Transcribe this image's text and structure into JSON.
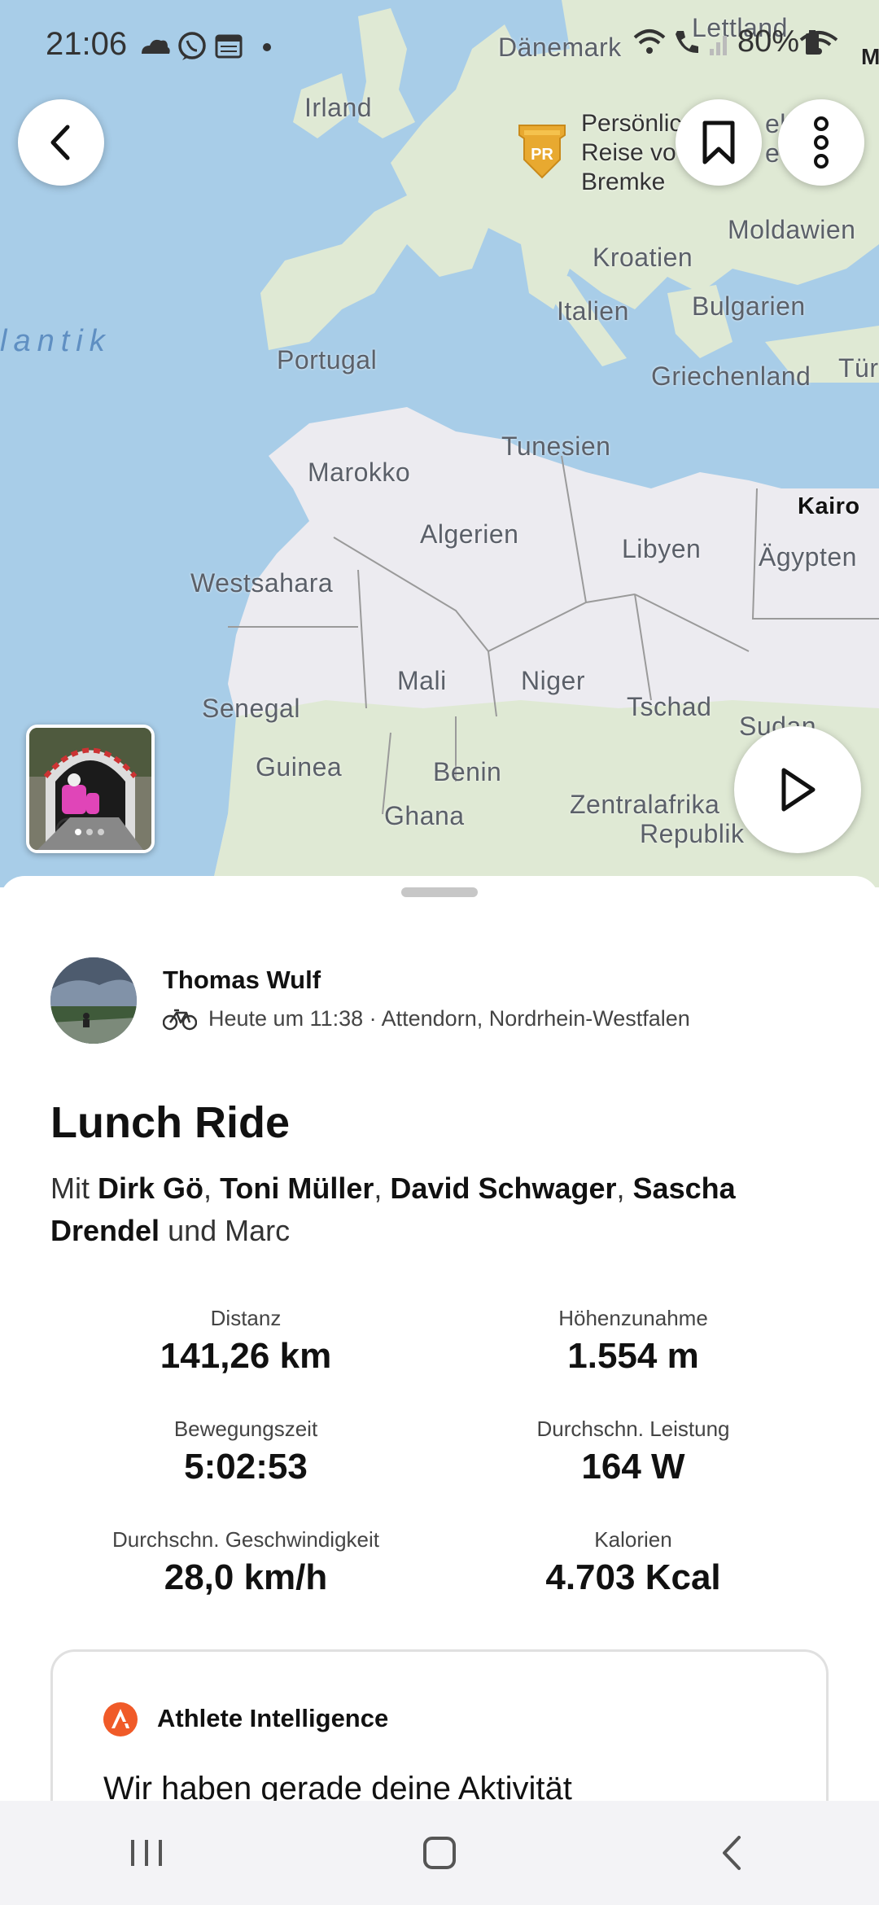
{
  "status_bar": {
    "time": "21:06",
    "battery": "80%",
    "left_icons": [
      "cloud-icon",
      "whatsapp-icon",
      "calendar-icon",
      "dot-icon"
    ],
    "right_icons": [
      "wifi-icon",
      "wifi-call-icon",
      "signal-icon",
      "battery-icon"
    ]
  },
  "map": {
    "labels": {
      "lettland": "Lettland",
      "daenemark": "Dänemark",
      "irland": "Irland",
      "moldawien": "Moldawien",
      "kroatien": "Kroatien",
      "italien": "Italien",
      "bulgarien": "Bulgarien",
      "atlantik": "lantik",
      "portugal": "Portugal",
      "griechenland": "Griechenland",
      "tuerkei": "Tür",
      "tunesien": "Tunesien",
      "marokko": "Marokko",
      "kairo": "Kairo",
      "algerien": "Algerien",
      "libyen": "Libyen",
      "aegypten": "Ägypten",
      "westsahara": "Westsahara",
      "mali": "Mali",
      "niger": "Niger",
      "tschad": "Tschad",
      "senegal": "Senegal",
      "sudan": "Sudan",
      "guinea": "Guinea",
      "benin": "Benin",
      "ghana": "Ghana",
      "zentralafrika": "Zentralafrika",
      "republik": "Republik",
      "m": "M"
    },
    "pr_badge": "PR",
    "pr_text": [
      "Persönlic",
      "Reise vo",
      "Bremke"
    ],
    "pr_text_partial": [
      "ek",
      "e"
    ],
    "photo_count": 3
  },
  "activity": {
    "athlete_name": "Thomas Wulf",
    "meta": "Heute um 11:38 · Attendorn, Nordrhein-Westfalen",
    "title": "Lunch Ride",
    "with_prefix": "Mit",
    "companions": [
      "Dirk Gö",
      "Toni Müller",
      "David Schwager",
      "Sascha Drendel"
    ],
    "companions_suffix": "und Marc",
    "stats": [
      {
        "label": "Distanz",
        "value": "141,26 km"
      },
      {
        "label": "Höhenzunahme",
        "value": "1.554 m"
      },
      {
        "label": "Bewegungszeit",
        "value": "5:02:53"
      },
      {
        "label": "Durchschn. Leistung",
        "value": "164 W"
      },
      {
        "label": "Durchschn. Geschwindigkeit",
        "value": "28,0 km/h"
      },
      {
        "label": "Kalorien",
        "value": "4.703 Kcal"
      }
    ],
    "ai_card": {
      "title": "Athlete Intelligence",
      "text": "Wir haben gerade deine Aktivität"
    }
  },
  "colors": {
    "accent": "#f05a28",
    "pr_gold": "#e8a930",
    "ocean": "#a8cde8",
    "land": "#dfe9d4"
  }
}
